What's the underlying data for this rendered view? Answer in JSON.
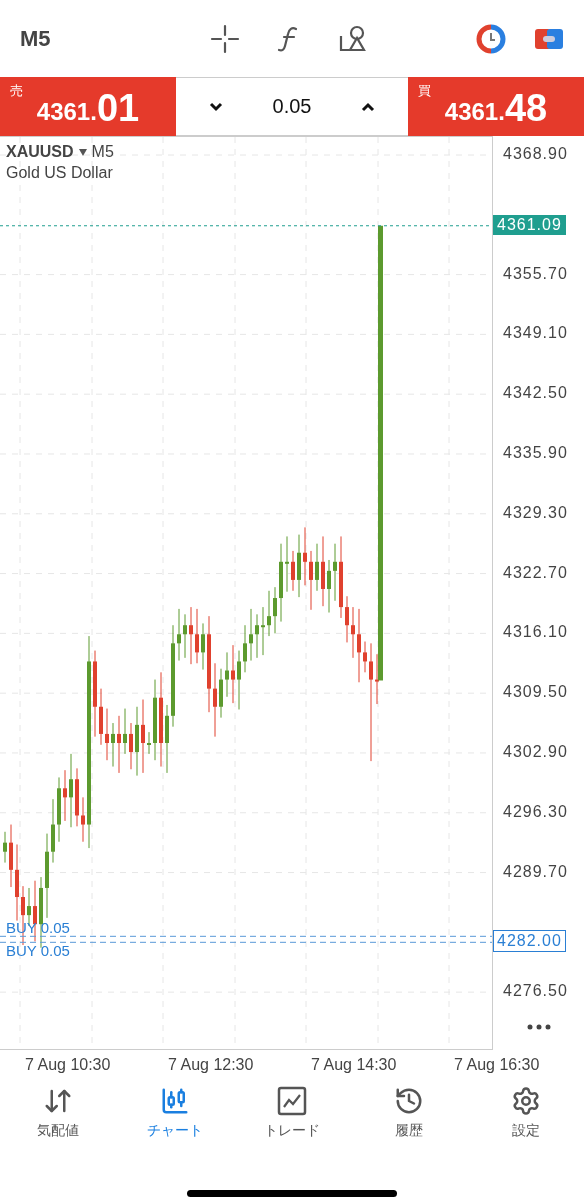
{
  "header": {
    "timeframe": "M5"
  },
  "trade_bar": {
    "sell": {
      "label": "売",
      "price_main": "4361.",
      "price_big": "01"
    },
    "volume": "0.05",
    "buy": {
      "label": "買",
      "price_main": "4361.",
      "price_big": "48"
    }
  },
  "chart": {
    "symbol": "XAUUSD",
    "timeframe": "M5",
    "description": "Gold US Dollar",
    "price_ticks": [
      "4368.90",
      "4355.70",
      "4349.10",
      "4342.50",
      "4335.90",
      "4329.30",
      "4322.70",
      "4316.10",
      "4309.50",
      "4302.90",
      "4296.30",
      "4289.70",
      "4276.50"
    ],
    "current_price": "4361.09",
    "order_lines": [
      {
        "label": "BUY 0.05"
      },
      {
        "label": "BUY 0.05",
        "price_label": "4282.00"
      }
    ],
    "time_labels": [
      "7 Aug 10:30",
      "7 Aug 12:30",
      "7 Aug 14:30",
      "7 Aug 16:30"
    ]
  },
  "tabs": [
    {
      "label": "気配値",
      "kind": "quotes",
      "selected": false
    },
    {
      "label": "チャート",
      "kind": "chart",
      "selected": true
    },
    {
      "label": "トレード",
      "kind": "trade",
      "selected": false
    },
    {
      "label": "履歴",
      "kind": "history",
      "selected": false
    },
    {
      "label": "設定",
      "kind": "settings",
      "selected": false
    }
  ]
}
